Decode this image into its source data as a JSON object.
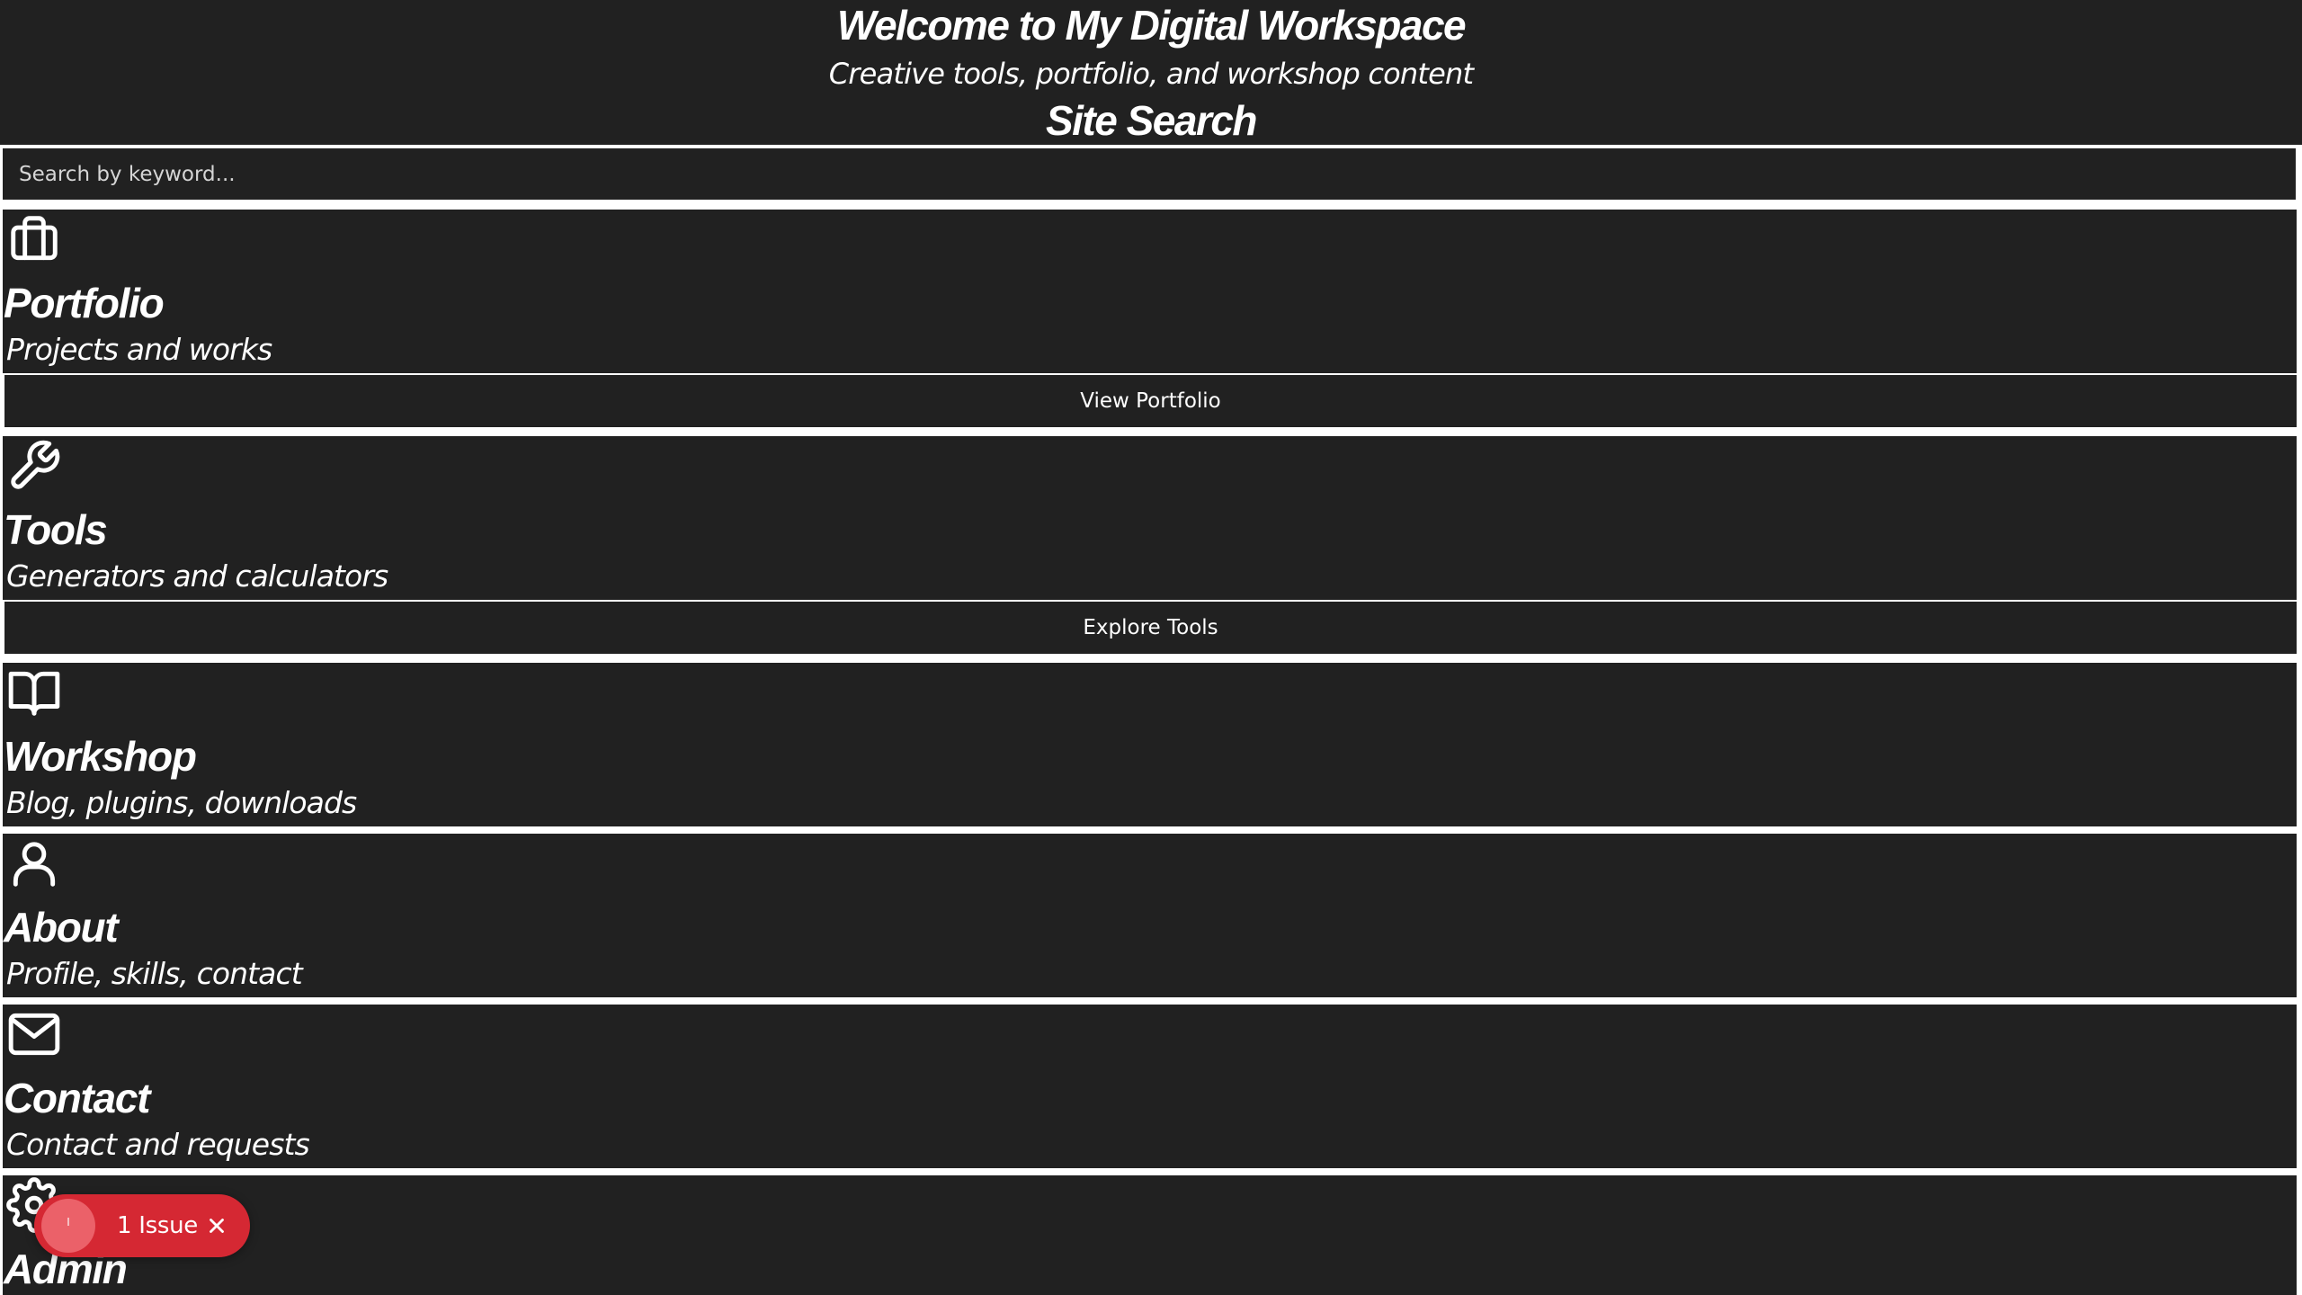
{
  "header": {
    "title": "Welcome to My Digital Workspace",
    "subtitle": "Creative tools, portfolio, and workshop content",
    "search_heading": "Site Search"
  },
  "search": {
    "placeholder": "Search by keyword...",
    "value": ""
  },
  "cards": [
    {
      "icon": "briefcase-icon",
      "title": "Portfolio",
      "description": "Projects and works",
      "button": "View Portfolio"
    },
    {
      "icon": "wrench-icon",
      "title": "Tools",
      "description": "Generators and calculators",
      "button": "Explore Tools"
    },
    {
      "icon": "book-icon",
      "title": "Workshop",
      "description": "Blog, plugins, downloads"
    },
    {
      "icon": "user-icon",
      "title": "About",
      "description": "Profile, skills, contact"
    },
    {
      "icon": "mail-icon",
      "title": "Contact",
      "description": "Contact and requests"
    },
    {
      "icon": "gear-icon",
      "title": "Admin"
    }
  ],
  "issue_badge": {
    "label": "1 Issue",
    "icon": "close-icon"
  },
  "colors": {
    "background": "#ffffff",
    "panel": "#212121",
    "text": "#ffffff",
    "issue": "#d52833"
  }
}
